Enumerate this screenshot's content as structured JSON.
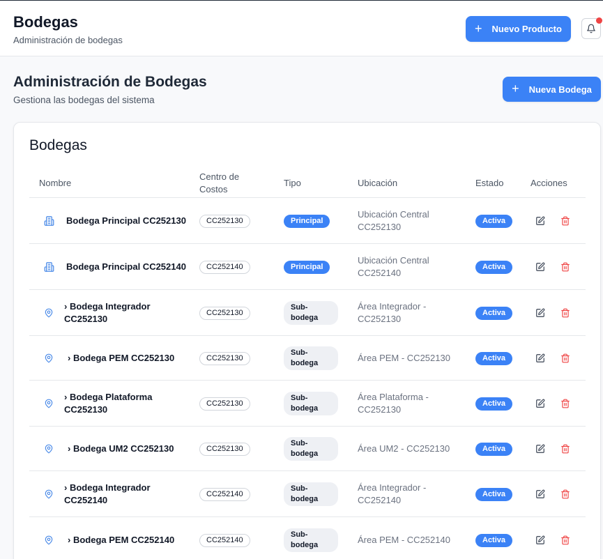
{
  "header": {
    "title": "Bodegas",
    "subtitle": "Administración de bodegas",
    "new_product_label": "Nuevo Producto"
  },
  "page": {
    "title": "Administración de Bodegas",
    "subtitle": "Gestiona las bodegas del sistema",
    "new_bodega_label": "Nueva Bodega"
  },
  "card": {
    "title": "Bodegas",
    "columns": {
      "nombre": "Nombre",
      "centro_line1": "Centro de",
      "centro_line2": "Costos",
      "tipo": "Tipo",
      "ubicacion": "Ubicación",
      "estado": "Estado",
      "acciones": "Acciones"
    }
  },
  "rows": [
    {
      "icon": "building-icon",
      "chevron": "",
      "name_line1": "Bodega Principal CC252130",
      "name_line2": "",
      "cc": "CC252130",
      "tipo_line1": "Principal",
      "tipo_line2": "",
      "ubic_line1": "Ubicación Central",
      "ubic_line2": "CC252130",
      "estado": "Activa"
    },
    {
      "icon": "building-icon",
      "chevron": "",
      "name_line1": "Bodega Principal CC252140",
      "name_line2": "",
      "cc": "CC252140",
      "tipo_line1": "Principal",
      "tipo_line2": "",
      "ubic_line1": "Ubicación Central",
      "ubic_line2": "CC252140",
      "estado": "Activa"
    },
    {
      "icon": "map-pin-icon",
      "chevron": "›",
      "name_line1": "Bodega Integrador",
      "name_line2": "CC252130",
      "cc": "CC252130",
      "tipo_line1": "Sub-",
      "tipo_line2": "bodega",
      "ubic_line1": "Área Integrador -",
      "ubic_line2": "CC252130",
      "estado": "Activa"
    },
    {
      "icon": "map-pin-icon",
      "chevron": "›",
      "name_line1": "Bodega PEM CC252130",
      "name_line2": "",
      "cc": "CC252130",
      "tipo_line1": "Sub-",
      "tipo_line2": "bodega",
      "ubic_line1": "Área PEM - CC252130",
      "ubic_line2": "",
      "estado": "Activa"
    },
    {
      "icon": "map-pin-icon",
      "chevron": "›",
      "name_line1": "Bodega Plataforma",
      "name_line2": "CC252130",
      "cc": "CC252130",
      "tipo_line1": "Sub-",
      "tipo_line2": "bodega",
      "ubic_line1": "Área Plataforma -",
      "ubic_line2": "CC252130",
      "estado": "Activa"
    },
    {
      "icon": "map-pin-icon",
      "chevron": "›",
      "name_line1": "Bodega UM2 CC252130",
      "name_line2": "",
      "cc": "CC252130",
      "tipo_line1": "Sub-",
      "tipo_line2": "bodega",
      "ubic_line1": "Área UM2 - CC252130",
      "ubic_line2": "",
      "estado": "Activa"
    },
    {
      "icon": "map-pin-icon",
      "chevron": "›",
      "name_line1": "Bodega Integrador",
      "name_line2": "CC252140",
      "cc": "CC252140",
      "tipo_line1": "Sub-",
      "tipo_line2": "bodega",
      "ubic_line1": "Área Integrador -",
      "ubic_line2": "CC252140",
      "estado": "Activa"
    },
    {
      "icon": "map-pin-icon",
      "chevron": "›",
      "name_line1": "Bodega PEM CC252140",
      "name_line2": "",
      "cc": "CC252140",
      "tipo_line1": "Sub-",
      "tipo_line2": "bodega",
      "ubic_line1": "Área PEM - CC252140",
      "ubic_line2": "",
      "estado": "Activa"
    }
  ],
  "theme": {
    "accent": "#3b82f6",
    "danger": "#ef4444",
    "icon_blue": "#4a8ae8"
  }
}
